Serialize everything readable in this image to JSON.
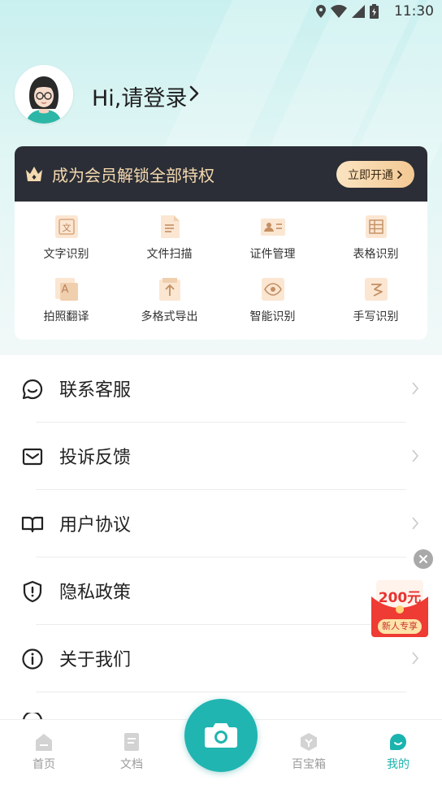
{
  "status_bar": {
    "time": "11:30"
  },
  "profile": {
    "login_text": "Hi,请登录"
  },
  "vip": {
    "text": "成为会员解锁全部特权",
    "button": "立即开通"
  },
  "features": [
    {
      "label": "文字识别",
      "icon": "text-recognition-icon"
    },
    {
      "label": "文件扫描",
      "icon": "file-scan-icon"
    },
    {
      "label": "证件管理",
      "icon": "id-card-icon"
    },
    {
      "label": "表格识别",
      "icon": "table-recognition-icon"
    },
    {
      "label": "拍照翻译",
      "icon": "photo-translate-icon"
    },
    {
      "label": "多格式导出",
      "icon": "export-icon"
    },
    {
      "label": "智能识别",
      "icon": "smart-recognition-icon"
    },
    {
      "label": "手写识别",
      "icon": "handwriting-icon"
    }
  ],
  "menu": [
    {
      "label": "联系客服",
      "icon": "chat-icon"
    },
    {
      "label": "投诉反馈",
      "icon": "mail-icon"
    },
    {
      "label": "用户协议",
      "icon": "book-icon"
    },
    {
      "label": "隐私政策",
      "icon": "shield-icon"
    },
    {
      "label": "关于我们",
      "icon": "info-icon"
    }
  ],
  "promo": {
    "amount": "200元",
    "label": "新人专享"
  },
  "tabs": [
    {
      "label": "首页",
      "icon": "home-icon",
      "active": false
    },
    {
      "label": "文档",
      "icon": "document-icon",
      "active": false
    },
    {
      "label": "百宝箱",
      "icon": "toolbox-icon",
      "active": false
    },
    {
      "label": "我的",
      "icon": "profile-icon",
      "active": true
    }
  ],
  "colors": {
    "accent": "#21b5b1",
    "vip_bar": "#2b2e36",
    "vip_text": "#f5d9b0",
    "promo_red": "#e8322f"
  }
}
